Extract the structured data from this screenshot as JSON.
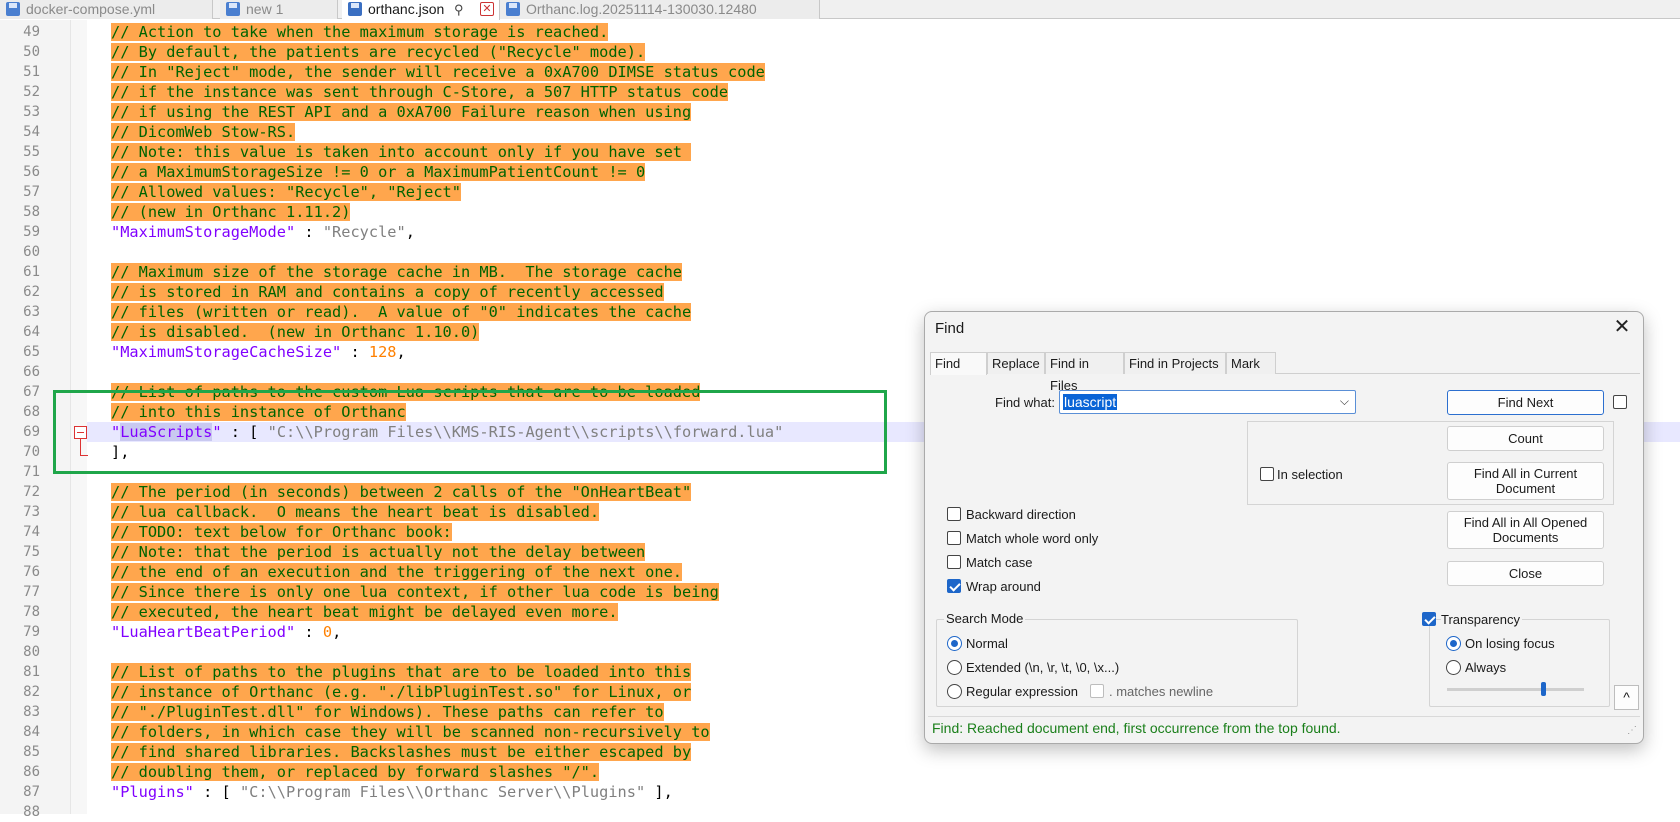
{
  "tabs": [
    {
      "label": "docker-compose.yml",
      "active": false
    },
    {
      "label": "new 1",
      "active": false
    },
    {
      "label": "orthanc.json",
      "active": true
    },
    {
      "label": "Orthanc.log.20251114-130030.12480",
      "active": false
    }
  ],
  "editor": {
    "lines": [
      {
        "n": "49",
        "text": "// Action to take when the maximum storage is reached.",
        "type": "comment"
      },
      {
        "n": "50",
        "text": "// By default, the patients are recycled (\"Recycle\" mode).",
        "type": "comment"
      },
      {
        "n": "51",
        "text": "// In \"Reject\" mode, the sender will receive a 0xA700 DIMSE status code",
        "type": "comment"
      },
      {
        "n": "52",
        "text": "// if the instance was sent through C-Store, a 507 HTTP status code",
        "type": "comment"
      },
      {
        "n": "53",
        "text": "// if using the REST API and a 0xA700 Failure reason when using",
        "type": "comment"
      },
      {
        "n": "54",
        "text": "// DicomWeb Stow-RS.",
        "type": "comment"
      },
      {
        "n": "55",
        "text": "// Note: this value is taken into account only if you have set ",
        "type": "comment"
      },
      {
        "n": "56",
        "text": "// a MaximumStorageSize != 0 or a MaximumPatientCount != 0",
        "type": "comment"
      },
      {
        "n": "57",
        "text": "// Allowed values: \"Recycle\", \"Reject\"",
        "type": "comment"
      },
      {
        "n": "58",
        "text": "// (new in Orthanc 1.11.2)",
        "type": "comment"
      },
      {
        "n": "59",
        "key": "\"MaximumStorageMode\"",
        "sep": " : ",
        "val": "\"Recycle\"",
        "valtype": "str",
        "tail": ",",
        "type": "kv"
      },
      {
        "n": "60",
        "text": "",
        "type": "blank"
      },
      {
        "n": "61",
        "text": "// Maximum size of the storage cache in MB.  The storage cache",
        "type": "comment"
      },
      {
        "n": "62",
        "text": "// is stored in RAM and contains a copy of recently accessed",
        "type": "comment"
      },
      {
        "n": "63",
        "text": "// files (written or read).  A value of \"0\" indicates the cache",
        "type": "comment"
      },
      {
        "n": "64",
        "text": "// is disabled.  (new in Orthanc 1.10.0)",
        "type": "comment"
      },
      {
        "n": "65",
        "key": "\"MaximumStorageCacheSize\"",
        "sep": " : ",
        "val": "128",
        "valtype": "num",
        "tail": ",",
        "type": "kv"
      },
      {
        "n": "66",
        "text": "",
        "type": "blank"
      },
      {
        "n": "67",
        "text": "// List of paths to the custom Lua scripts that are to be loaded",
        "type": "comment"
      },
      {
        "n": "68",
        "text": "// into this instance of Orthanc",
        "type": "comment"
      },
      {
        "n": "69",
        "keyq": "\"",
        "keysel": "LuaScripts",
        "keyrest": "\"",
        "sep": " : [ ",
        "val": "\"C:\\\\Program Files\\\\KMS-RIS-Agent\\\\scripts\\\\forward.lua\"",
        "type": "kvsel"
      },
      {
        "n": "70",
        "text": "],",
        "type": "plain"
      },
      {
        "n": "71",
        "text": "",
        "type": "blank"
      },
      {
        "n": "72",
        "text": "// The period (in seconds) between 2 calls of the \"OnHeartBeat\"",
        "type": "comment"
      },
      {
        "n": "73",
        "text": "// lua callback.  O means the heart beat is disabled.",
        "type": "comment"
      },
      {
        "n": "74",
        "text": "// TODO: text below for Orthanc book:",
        "type": "comment"
      },
      {
        "n": "75",
        "text": "// Note: that the period is actually not the delay between",
        "type": "comment"
      },
      {
        "n": "76",
        "text": "// the end of an execution and the triggering of the next one.",
        "type": "comment"
      },
      {
        "n": "77",
        "text": "// Since there is only one lua context, if other lua code is being",
        "type": "comment"
      },
      {
        "n": "78",
        "text": "// executed, the heart beat might be delayed even more.",
        "type": "comment"
      },
      {
        "n": "79",
        "key": "\"LuaHeartBeatPeriod\"",
        "sep": " : ",
        "val": "0",
        "valtype": "num",
        "tail": ",",
        "type": "kv"
      },
      {
        "n": "80",
        "text": "",
        "type": "blank"
      },
      {
        "n": "81",
        "text": "// List of paths to the plugins that are to be loaded into this",
        "type": "comment"
      },
      {
        "n": "82",
        "text": "// instance of Orthanc (e.g. \"./libPluginTest.so\" for Linux, or",
        "type": "comment"
      },
      {
        "n": "83",
        "text": "// \"./PluginTest.dll\" for Windows). These paths can refer to",
        "type": "comment"
      },
      {
        "n": "84",
        "text": "// folders, in which case they will be scanned non-recursively to",
        "type": "comment"
      },
      {
        "n": "85",
        "text": "// find shared libraries. Backslashes must be either escaped by",
        "type": "comment"
      },
      {
        "n": "86",
        "text": "// doubling them, or replaced by forward slashes \"/\".",
        "type": "comment"
      },
      {
        "n": "87",
        "key": "\"Plugins\"",
        "sep": " : [ ",
        "val": "\"C:\\\\Program Files\\\\Orthanc Server\\\\Plugins\"",
        "valtype": "str",
        "tail": " ],",
        "type": "kv"
      },
      {
        "n": "88",
        "text": "",
        "type": "blank"
      }
    ]
  },
  "find_dialog": {
    "title": "Find",
    "tabs": [
      "Find",
      "Replace",
      "Find in Files",
      "Find in Projects",
      "Mark"
    ],
    "find_what_label": "Find what:",
    "find_what_value": "luascript",
    "in_selection_label": "In selection",
    "buttons": {
      "find_next": "Find Next",
      "count": "Count",
      "find_all_current_l1": "Find All in Current",
      "find_all_current_l2": "Document",
      "find_all_opened_l1": "Find All in All Opened",
      "find_all_opened_l2": "Documents",
      "close": "Close"
    },
    "options": {
      "backward": "Backward direction",
      "whole_word": "Match whole word only",
      "match_case": "Match case",
      "wrap_around": "Wrap around"
    },
    "search_mode": {
      "title": "Search Mode",
      "normal": "Normal",
      "extended": "Extended (\\n, \\r, \\t, \\0, \\x...)",
      "regex": "Regular expression",
      "matches_newline": ". matches newline"
    },
    "transparency": {
      "label": "Transparency",
      "on_losing_focus": "On losing focus",
      "always": "Always",
      "level": 0.7
    },
    "status": "Find: Reached document end, first occurrence from the top found."
  }
}
